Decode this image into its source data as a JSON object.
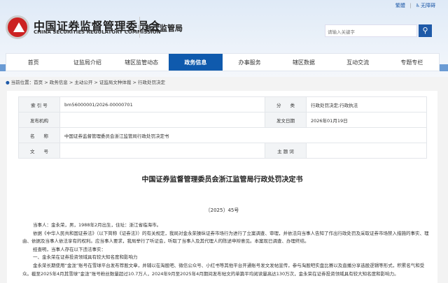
{
  "header": {
    "traditional": "繁體",
    "accessibility": "无障碍",
    "org_cn": "中国证券监督管理委员会",
    "org_en": "CHINA SECURITIES REGULATORY COMMISSION",
    "bureau": "浙江监管局",
    "search_placeholder": "请输入关键字"
  },
  "nav": [
    "首页",
    "证监局介绍",
    "辖区监管动态",
    "政务信息",
    "办事服务",
    "辖区数据",
    "互动交流",
    "专题专栏"
  ],
  "breadcrumb": "当前位置：首页 > 政务信息 > 主动公开 > 证监局文种体裁 > 行政处罚决定",
  "meta": {
    "index_label": "索 引 号",
    "index": "bm56000001/2026-00000701",
    "category_label": "分　　类",
    "category": "行政处罚决定;行政执法",
    "publisher_label": "发布机构",
    "publisher": "",
    "date_label": "发文日期",
    "date": "2026年01月19日",
    "name_label": "名　　称",
    "name": "中国证券监督管理委员会浙江监管局行政处罚决定书",
    "docno_label": "文　　号",
    "docno": "",
    "keywords_label": "主 题 词",
    "keywords": ""
  },
  "doc": {
    "title": "中国证券监督管理委员会浙江监管局行政处罚决定书",
    "number": "〔2025〕45号",
    "paragraphs": [
      "当事人：金永荣，男，1988年2月出生，住址：浙江省临海市。",
      "依据《中华人民共和国证券法》（以下简称《证券法》）的有关规定，我局对金永荣操纵证券市场行为进行了立案调查、审理，并依法向当事人告知了作出行政处罚及采取证券市场禁入措施的事实、理由、依据及当事人依法享有的权利。应当事人要求，我局举行了听证会，听取了当事人及其代理人的陈述申辩意见。本案现已调查、办理终结。",
      "经查明，当事人存在以下违法事实：",
      "一、金永荣在证券投资领域具有较大知名度和影响力",
      "金永荣长期使用“金泷”账号在雪球平台发布荐股文章，并辅以在淘股吧、微信公众号、小红书等其他平台开通账号发文发帖宣传，参与淘股吧实盘比赛以及直播分享选股逻辑等形式，积累名气和受众。截至2025年4月其雪球“金泷”账号粉丝数量超过10.7万人，2024年9月至2025年4月期间发布帖文的单篇平均阅读量高达130万次，金永荣在证券投资领域具有较大知名度和影响力。"
    ]
  }
}
